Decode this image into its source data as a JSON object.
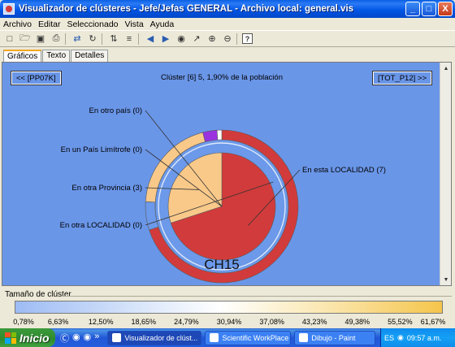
{
  "window": {
    "title": "Visualizador de clústeres - Jefe/Jefas GENERAL - Archivo local: general.vis",
    "controls": [
      "_",
      "□",
      "X"
    ]
  },
  "menu": [
    "Archivo",
    "Editar",
    "Seleccionado",
    "Vista",
    "Ayuda"
  ],
  "toolbar": {
    "icons": [
      "new-icon",
      "open-icon",
      "save-icon",
      "print-icon",
      "swap-icon",
      "rotate-icon",
      "sort-icon",
      "align-icon",
      "arrow-left-icon",
      "arrow-right-icon",
      "binoculars-icon",
      "wand-icon",
      "zoom-in-icon",
      "zoom-out-icon",
      "help-icon"
    ],
    "help_label": "?"
  },
  "tabs": [
    {
      "label": "Gráficos",
      "active": true
    },
    {
      "label": "Texto",
      "active": false
    },
    {
      "label": "Detalles",
      "active": false
    }
  ],
  "cluster": {
    "prev_button": "<< [PP07K]",
    "next_button": "[TOT_P12] >>",
    "header": "Clúster [6] 5, 1,90% de la población",
    "name": "CH15"
  },
  "chart_data": {
    "type": "pie",
    "slices": [
      {
        "label": "En esta LOCALIDAD (7)",
        "count": 7,
        "color": "#D23B3B"
      },
      {
        "label": "En otra LOCALIDAD (0)",
        "count": 0,
        "color": "#6C99E9"
      },
      {
        "label": "En otra Provincia (3)",
        "count": 3,
        "color": "#F9C98A"
      },
      {
        "label": "En un País Limítrofe (0)",
        "count": 0,
        "color": "#6C99E9"
      },
      {
        "label": "En otro país (0)",
        "count": 0,
        "color": "#6C99E9"
      }
    ],
    "outer_ring": [
      {
        "label": "En esta LOCALIDAD",
        "fraction": 0.7,
        "color": "#D23B3B"
      },
      {
        "label": "En otra LOCALIDAD",
        "fraction": 0.06,
        "color": "#6C99E9"
      },
      {
        "label": "En otra Provincia",
        "fraction": 0.2,
        "color": "#F9C98A"
      },
      {
        "label": "En otro país",
        "fraction": 0.03,
        "color": "#9A32E0"
      },
      {
        "label": "En un País Limítrofe",
        "fraction": 0.01,
        "color": "#FFFFFF"
      }
    ],
    "background": "#6A96E8"
  },
  "size_scale": {
    "label": "Tamaño de clúster",
    "ticks": [
      "0,78%",
      "6,63%",
      "12,50%",
      "18,65%",
      "24,79%",
      "30,94%",
      "37,08%",
      "43,23%",
      "49,38%",
      "55,52%",
      "61,67%"
    ]
  },
  "taskbar": {
    "start_label": "Inicio",
    "tasks": [
      {
        "label": "Visualizador de clúst...",
        "active": true
      },
      {
        "label": "Scientific WorkPlace ...",
        "active": false
      },
      {
        "label": "Dibujo - Paint",
        "active": false
      }
    ],
    "lang": "ES",
    "clock": "09:57 a.m."
  }
}
